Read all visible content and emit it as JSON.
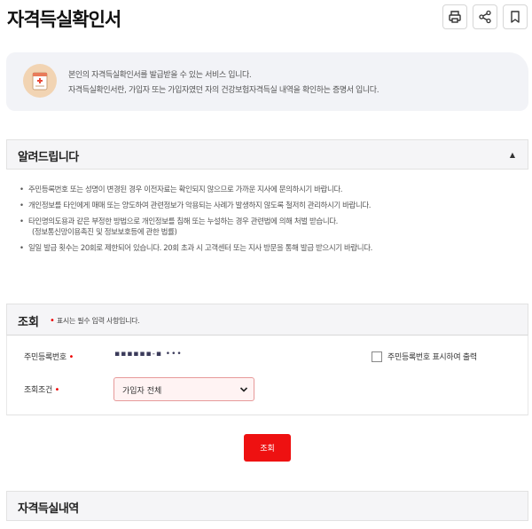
{
  "header": {
    "title": "자격득실확인서",
    "actions": [
      "print-icon",
      "share-icon",
      "bookmark-icon"
    ]
  },
  "intro": {
    "icon": "document-cross-icon",
    "line1": "본인의 자격득실확인서를 발급받을 수 있는 서비스 입니다.",
    "line2": "자격득실확인서란, 가입자 또는 가입자였던 자의 건강보험자격득실 내역을 확인하는 증명서 입니다."
  },
  "notice": {
    "title": "알려드립니다",
    "toggle": "▲",
    "items": [
      "주민등록번호 또는 성명이 변경된 경우 이전자료는 확인되지 않으므로 가까운 지사에 문의하시기 바랍니다.",
      "개인정보를 타인에게 매매 또는 양도하여 관련정보가 악용되는 사례가 발생하지 않도록 철저히 관리하시기 바랍니다.",
      "타인명의도용과 같은 부정한 방법으로 개인정보를 침해 또는 누설하는 경우 관련법에 의해 처벌 받습니다.",
      "일일 발급 횟수는 20회로 제한되어 있습니다. 20회 초과 시 고객센터 또는 지사 방문을 통해 발급 받으시기 바랍니다."
    ],
    "sub_item": "(정보통신망이용촉진 및 정보보호등에 관한 법률)"
  },
  "query": {
    "title": "조회",
    "required_mark": "•",
    "required_note": "표시는 필수 입력 사항입니다.",
    "rrn_label": "주민등록번호",
    "rrn_value": "▪▪▪▪▪▪-▪ •••",
    "checkbox_label": "주민등록번호 표시하여 출력",
    "condition_label": "조회조건",
    "condition_value": "가입자 전체",
    "accent_color": "#ee1111"
  },
  "submit": {
    "label": "조회"
  },
  "result": {
    "title": "자격득실내역"
  }
}
